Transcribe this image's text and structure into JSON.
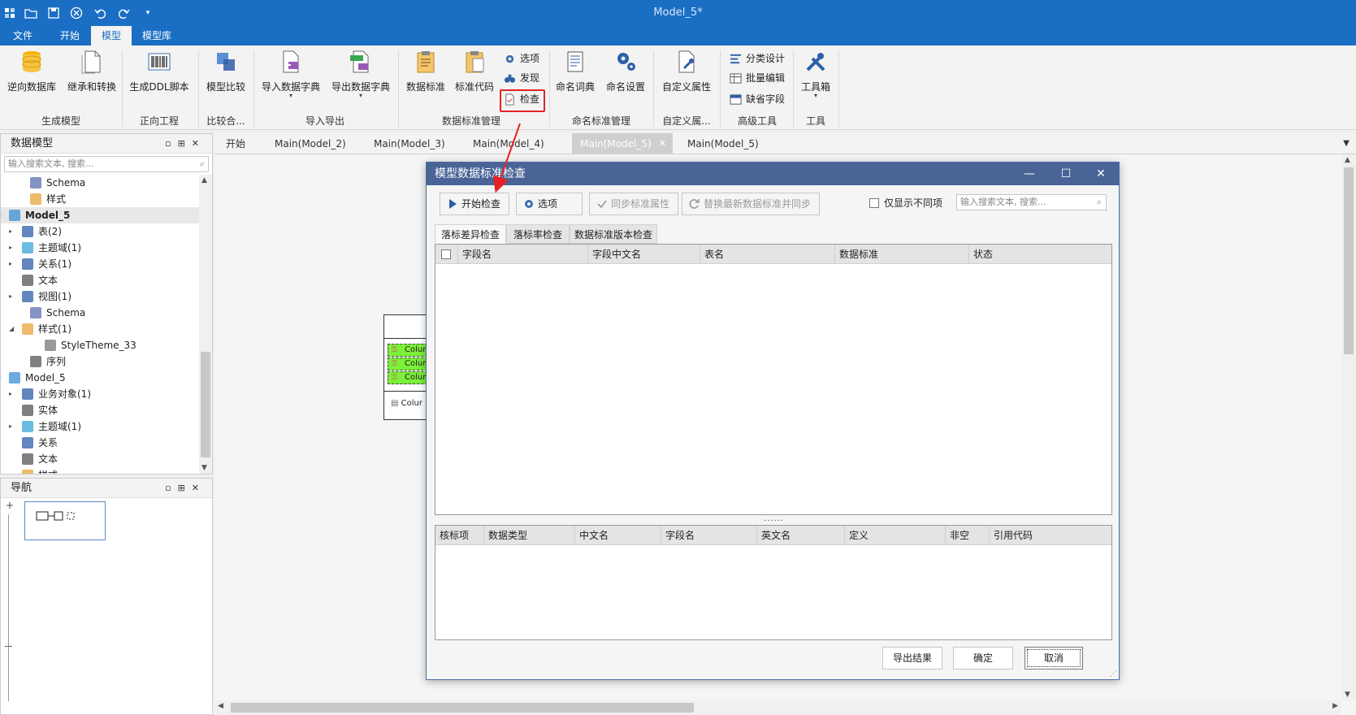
{
  "window": {
    "title": "Model_5*"
  },
  "ribbon_tabs": [
    "文件",
    "开始",
    "模型",
    "模型库"
  ],
  "ribbon": {
    "buttons": {
      "reverse_db": "逆向数据库",
      "inherit_convert": "继承和转换",
      "gen_ddl": "生成DDL脚本",
      "model_compare": "模型比较",
      "import_dict": "导入数据字典",
      "export_dict": "导出数据字典",
      "data_standard": "数据标准",
      "standard_code": "标准代码",
      "options": "选项",
      "discover": "发现",
      "check": "检查",
      "naming_dict": "命名词典",
      "naming_settings": "命名设置",
      "custom_attr": "自定义属性",
      "classify_design": "分类设计",
      "batch_edit": "批量编辑",
      "default_field": "缺省字段",
      "toolbox": "工具箱"
    },
    "groups": {
      "generate_model": "生成模型",
      "forward_eng": "正向工程",
      "compare": "比较合...",
      "import_export": "导入导出",
      "std_mgmt": "数据标准管理",
      "naming_mgmt": "命名标准管理",
      "custom": "自定义属...",
      "advanced": "高级工具",
      "tools": "工具"
    }
  },
  "model_panel": {
    "title": "数据模型",
    "search_placeholder": "输入搜索文本, 搜索...",
    "tree": [
      {
        "label": "Schema"
      },
      {
        "label": "样式"
      },
      {
        "label": "Model_5"
      },
      {
        "label": "表(2)"
      },
      {
        "label": "主题域(1)"
      },
      {
        "label": "关系(1)"
      },
      {
        "label": "文本"
      },
      {
        "label": "视图(1)"
      },
      {
        "label": "Schema"
      },
      {
        "label": "样式(1)"
      },
      {
        "label": "StyleTheme_33"
      },
      {
        "label": "序列"
      },
      {
        "label": "Model_5"
      },
      {
        "label": "业务对象(1)"
      },
      {
        "label": "实体"
      },
      {
        "label": "主题域(1)"
      },
      {
        "label": "关系"
      },
      {
        "label": "文本"
      },
      {
        "label": "样式"
      }
    ]
  },
  "nav_panel": {
    "title": "导航"
  },
  "doc_tabs": [
    "开始",
    "Main(Model_2)",
    "Main(Model_3)",
    "Main(Model_4)",
    "Main(Model_5)",
    "Main(Model_5)"
  ],
  "canvas": {
    "entity_columns": [
      "Colur",
      "Colur",
      "Colur"
    ],
    "entity_footer": "Colur"
  },
  "dialog": {
    "title": "模型数据标准检查",
    "toolbar": {
      "start_check": "开始检查",
      "options": "选项",
      "sync_attr": "同步标准属性",
      "replace_sync": "替换最新数据标准并同步",
      "only_diff": "仅显示不同项",
      "search_placeholder": "输入搜索文本, 搜索..."
    },
    "sub_tabs": [
      "落标差异检查",
      "落标率检查",
      "数据标准版本检查"
    ],
    "top_grid_columns": [
      "字段名",
      "字段中文名",
      "表名",
      "数据标准",
      "状态"
    ],
    "bottom_grid_columns": [
      "核标项",
      "数据类型",
      "中文名",
      "字段名",
      "英文名",
      "定义",
      "非空",
      "引用代码"
    ],
    "footer": {
      "export": "导出结果",
      "ok": "确定",
      "cancel": "取消"
    }
  },
  "colors": {
    "title_blue": "#1a6fc4",
    "dialog_title": "#4a6497",
    "highlight_red": "#e52222",
    "entity_green": "#7cf03a"
  }
}
